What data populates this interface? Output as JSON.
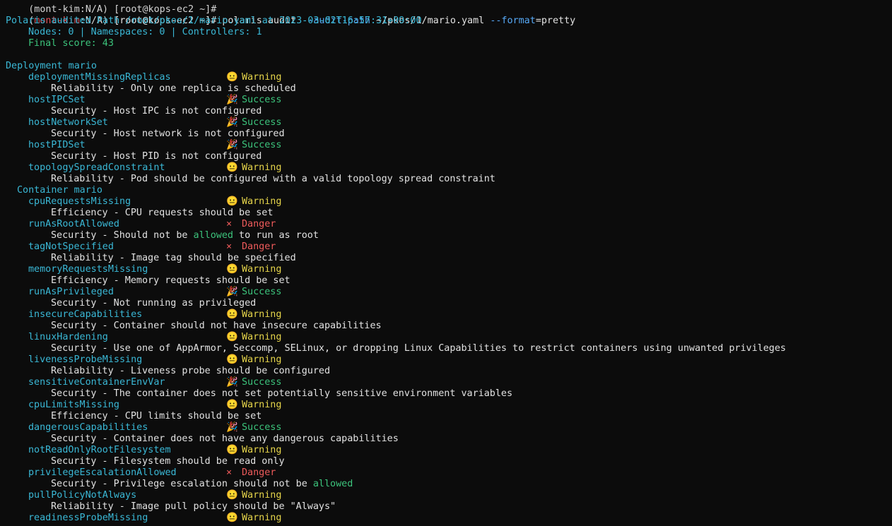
{
  "prompt": {
    "top_cut": "(mont-kim:N/A) [root@kops-ec2 ~]#",
    "ctx_open": "(",
    "user": "mont-kim",
    "ctx_rest": ":N/A) ",
    "host": "[root@kops-ec2 ~]#",
    "command_main": "polaris audit ",
    "flag1": "--audit-path",
    "path": " ~/pkos/1/mario.yaml ",
    "flag2": "--format",
    "flag2_val": "=pretty"
  },
  "header": {
    "audited": "Polaris audited Path /root/pkos/1/mario.yaml at 2023-03-02T16:57:31+09:00",
    "counts": "Nodes: 0 | Namespaces: 0 | Controllers: 1",
    "score": "Final score: 43"
  },
  "deployment_heading": "Deployment mario",
  "container_heading": "Container mario",
  "icons": {
    "warning": "😐",
    "success": "🎉",
    "danger": "×"
  },
  "colors": {
    "warning": "#e5d44a",
    "success": "#3cc47c",
    "danger": "#ef5b5b",
    "check": "#3ab8d6"
  },
  "deployment_checks": [
    {
      "name": "deploymentMissingReplicas",
      "status": "Warning",
      "kind": "warning",
      "detail": "Reliability - Only one replica is scheduled"
    },
    {
      "name": "hostIPCSet",
      "status": "Success",
      "kind": "success",
      "detail": "Security - Host IPC is not configured"
    },
    {
      "name": "hostNetworkSet",
      "status": "Success",
      "kind": "success",
      "detail": "Security - Host network is not configured"
    },
    {
      "name": "hostPIDSet",
      "status": "Success",
      "kind": "success",
      "detail": "Security - Host PID is not configured"
    },
    {
      "name": "topologySpreadConstraint",
      "status": "Warning",
      "kind": "warning",
      "detail": "Reliability - Pod should be configured with a valid topology spread constraint"
    }
  ],
  "container_checks": [
    {
      "name": "cpuRequestsMissing",
      "status": "Warning",
      "kind": "warning",
      "detail": "Efficiency - CPU requests should be set"
    },
    {
      "name": "runAsRootAllowed",
      "status": "Danger",
      "kind": "danger",
      "detail_pre": "Security - Should not be ",
      "detail_hl": "allowed",
      "detail_post": " to run as root"
    },
    {
      "name": "tagNotSpecified",
      "status": "Danger",
      "kind": "danger",
      "detail": "Reliability - Image tag should be specified"
    },
    {
      "name": "memoryRequestsMissing",
      "status": "Warning",
      "kind": "warning",
      "detail": "Efficiency - Memory requests should be set"
    },
    {
      "name": "runAsPrivileged",
      "status": "Success",
      "kind": "success",
      "detail": "Security - Not running as privileged"
    },
    {
      "name": "insecureCapabilities",
      "status": "Warning",
      "kind": "warning",
      "detail": "Security - Container should not have insecure capabilities"
    },
    {
      "name": "linuxHardening",
      "status": "Warning",
      "kind": "warning",
      "detail": "Security - Use one of AppArmor, Seccomp, SELinux, or dropping Linux Capabilities to restrict containers using unwanted privileges"
    },
    {
      "name": "livenessProbeMissing",
      "status": "Warning",
      "kind": "warning",
      "detail": "Reliability - Liveness probe should be configured"
    },
    {
      "name": "sensitiveContainerEnvVar",
      "status": "Success",
      "kind": "success",
      "detail": "Security - The container does not set potentially sensitive environment variables"
    },
    {
      "name": "cpuLimitsMissing",
      "status": "Warning",
      "kind": "warning",
      "detail": "Efficiency - CPU limits should be set"
    },
    {
      "name": "dangerousCapabilities",
      "status": "Success",
      "kind": "success",
      "detail": "Security - Container does not have any dangerous capabilities"
    },
    {
      "name": "notReadOnlyRootFilesystem",
      "status": "Warning",
      "kind": "warning",
      "detail": "Security - Filesystem should be read only"
    },
    {
      "name": "privilegeEscalationAllowed",
      "status": "Danger",
      "kind": "danger",
      "detail_pre": "Security - Privilege escalation should not be ",
      "detail_hl": "allowed",
      "detail_post": ""
    },
    {
      "name": "pullPolicyNotAlways",
      "status": "Warning",
      "kind": "warning",
      "detail": "Reliability - Image pull policy should be \"Always\""
    },
    {
      "name": "readinessProbeMissing",
      "status": "Warning",
      "kind": "warning",
      "detail": ""
    }
  ]
}
